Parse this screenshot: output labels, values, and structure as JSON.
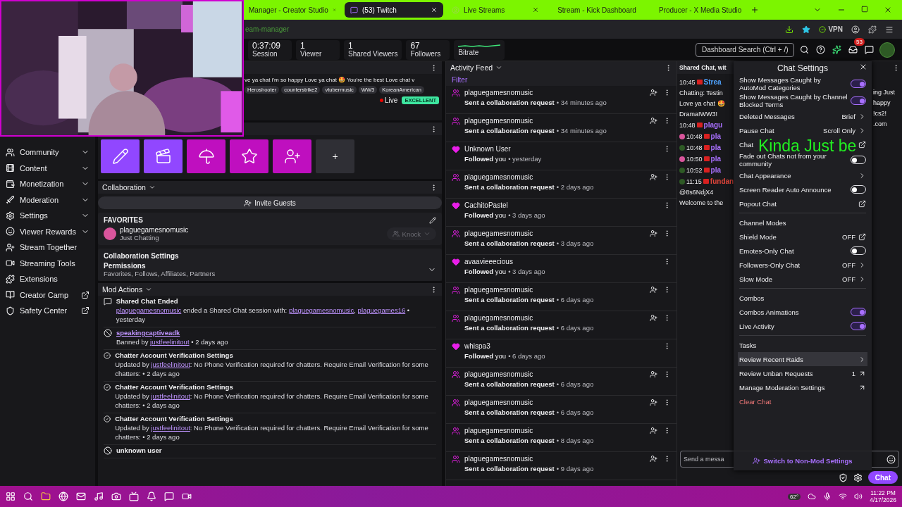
{
  "browser": {
    "tabs": [
      {
        "title": "Manager - Creator Studio",
        "selected": false,
        "kind": "studio"
      },
      {
        "title": "(53) Twitch",
        "selected": true,
        "kind": "twitch"
      },
      {
        "title": "Live Streams",
        "selected": false,
        "kind": "streams"
      },
      {
        "title": "Stream - Kick Dashboard",
        "selected": false,
        "kind": "kick"
      },
      {
        "title": "Producer - X Media Studio",
        "selected": false,
        "kind": "x"
      }
    ],
    "address": "eam-manager",
    "vpn": "VPN"
  },
  "stats": [
    {
      "kind": "number",
      "value": "0:37:09",
      "label": "Session"
    },
    {
      "kind": "number",
      "value": "1",
      "label": "Viewer"
    },
    {
      "kind": "number",
      "value": "1",
      "label": "Shared Viewers"
    },
    {
      "kind": "number",
      "value": "67",
      "label": "Followers"
    },
    {
      "kind": "graph",
      "label": "Bitrate"
    }
  ],
  "search": {
    "placeholder": "Dashboard Search (Ctrl + /)"
  },
  "notifications": {
    "count": "53"
  },
  "sidebar": {
    "items": [
      {
        "kind": "expandable",
        "label": "Community",
        "expanded": false
      },
      {
        "kind": "expandable",
        "label": "Content",
        "expanded": false
      },
      {
        "kind": "expandable",
        "label": "Monetization",
        "expanded": false
      },
      {
        "kind": "expandable",
        "label": "Moderation",
        "expanded": false
      },
      {
        "kind": "expandable",
        "label": "Settings",
        "expanded": false
      },
      {
        "kind": "expandable",
        "label": "Viewer Rewards",
        "expanded": false
      },
      {
        "kind": "link",
        "label": "Stream Together"
      },
      {
        "kind": "link",
        "label": "Streaming Tools"
      },
      {
        "kind": "link",
        "label": "Extensions"
      },
      {
        "kind": "external",
        "label": "Creator Camp"
      },
      {
        "kind": "external",
        "label": "Safety Center"
      }
    ]
  },
  "stream_info": {
    "title_text": "ve ya chat i'm so happy Love ya chat 🤩 You're the best Love chat v",
    "tags": [
      "Heroshooter",
      "counterstrike2",
      "vtubermusic",
      "WW3",
      "KoreanAmerican"
    ],
    "live_label": "Live",
    "health": "EXCELLENT"
  },
  "quick_actions": [
    {
      "kind": "pencil",
      "color": "#9147ff"
    },
    {
      "kind": "clapper",
      "color": "#9147ff"
    },
    {
      "kind": "umbrella",
      "color": "#bf0fbf"
    },
    {
      "kind": "star",
      "color": "#bf0fbf"
    },
    {
      "kind": "userplus",
      "color": "#bf0fbf"
    },
    {
      "kind": "add",
      "label": "+",
      "color": "#2f2f35"
    }
  ],
  "collaboration": {
    "title": "Collaboration",
    "invite": "Invite Guests",
    "favorites": {
      "heading": "FAVORITES",
      "user": "plaguegamesnomusic",
      "category": "Just Chatting",
      "knock": "Knock",
      "knock_disabled": true
    },
    "settings": {
      "title": "Collaboration Settings",
      "permissions": "Permissions",
      "permissions_value": "Favorites, Follows, Affiliates, Partners"
    }
  },
  "mod_actions": {
    "title": "Mod Actions",
    "items": [
      {
        "kind": "shared-chat",
        "title": "Shared Chat Ended",
        "title_link": false,
        "detail": [
          {
            "kind": "link",
            "text": "plaguegamesnomusic"
          },
          {
            "kind": "text",
            "text": " ended a Shared Chat session with: "
          },
          {
            "kind": "link",
            "text": "plaguegamesnomusic"
          },
          {
            "kind": "text",
            "text": ", "
          },
          {
            "kind": "link",
            "text": "plaguegames16"
          },
          {
            "kind": "text",
            "text": " • yesterday"
          }
        ]
      },
      {
        "kind": "ban",
        "title": "speakingcaptiveadk",
        "title_link": true,
        "detail": [
          {
            "kind": "text",
            "text": "Banned by "
          },
          {
            "kind": "link",
            "text": "justfeelinitout"
          },
          {
            "kind": "text",
            "text": " • 2 days ago"
          }
        ]
      },
      {
        "kind": "verified",
        "title": "Chatter Account Verification Settings",
        "title_link": false,
        "detail": [
          {
            "kind": "text",
            "text": "Updated by "
          },
          {
            "kind": "link",
            "text": "justfeelinitout"
          },
          {
            "kind": "text",
            "text": ": No Phone Verification required for chatters. Require Email Verification for some chatters:  • 2 days ago"
          }
        ]
      },
      {
        "kind": "verified",
        "title": "Chatter Account Verification Settings",
        "title_link": false,
        "detail": [
          {
            "kind": "text",
            "text": "Updated by "
          },
          {
            "kind": "link",
            "text": "justfeelinitout"
          },
          {
            "kind": "text",
            "text": ": No Phone Verification required for chatters. Require Email Verification for some chatters:  • 2 days ago"
          }
        ]
      },
      {
        "kind": "verified",
        "title": "Chatter Account Verification Settings",
        "title_link": false,
        "detail": [
          {
            "kind": "text",
            "text": "Updated by "
          },
          {
            "kind": "link",
            "text": "justfeelinitout"
          },
          {
            "kind": "text",
            "text": ": No Phone Verification required for chatters. Require Email Verification for some chatters:  • 2 days ago"
          }
        ]
      },
      {
        "kind": "ban",
        "title": "unknown user",
        "title_link": false
      }
    ]
  },
  "activity_feed": {
    "title": "Activity Feed",
    "filter": "Filter",
    "items": [
      {
        "kind": "collab",
        "user": "plaguegamesnomusic",
        "action": "Sent a collaboration request",
        "time": "• 34 minutes ago"
      },
      {
        "kind": "collab",
        "user": "plaguegamesnomusic",
        "action": "Sent a collaboration request",
        "time": "• 34 minutes ago"
      },
      {
        "kind": "follow",
        "user": "Unknown User",
        "action": "**Followed** you",
        "time": "• yesterday"
      },
      {
        "kind": "collab",
        "user": "plaguegamesnomusic",
        "action": "Sent a collaboration request",
        "time": "• 2 days ago"
      },
      {
        "kind": "follow",
        "user": "CachitoPastel",
        "action": "**Followed** you",
        "time": "• 3 days ago"
      },
      {
        "kind": "collab",
        "user": "plaguegamesnomusic",
        "action": "Sent a collaboration request",
        "time": "• 3 days ago"
      },
      {
        "kind": "follow",
        "user": "avaavieeecious",
        "action": "**Followed** you",
        "time": "• 3 days ago"
      },
      {
        "kind": "collab",
        "user": "plaguegamesnomusic",
        "action": "Sent a collaboration request",
        "time": "• 6 days ago"
      },
      {
        "kind": "collab",
        "user": "plaguegamesnomusic",
        "action": "Sent a collaboration request",
        "time": "• 6 days ago"
      },
      {
        "kind": "follow",
        "user": "whispa3",
        "action": "**Followed** you",
        "time": "• 6 days ago"
      },
      {
        "kind": "collab",
        "user": "plaguegamesnomusic",
        "action": "Sent a collaboration request",
        "time": "• 6 days ago"
      },
      {
        "kind": "collab",
        "user": "plaguegamesnomusic",
        "action": "Sent a collaboration request",
        "time": "• 6 days ago"
      },
      {
        "kind": "collab",
        "user": "plaguegamesnomusic",
        "action": "Sent a collaboration request",
        "time": "• 8 days ago"
      },
      {
        "kind": "collab",
        "user": "plaguegamesnomusic",
        "action": "Sent a collaboration request",
        "time": "• 9 days ago"
      }
    ]
  },
  "chat": {
    "header": "Shared Chat, wit",
    "lines": [
      {
        "kind": "message",
        "time": "10:45",
        "name": "Strea",
        "color": "#4fa3ff"
      },
      {
        "kind": "text",
        "text": "Chatting: Testin"
      },
      {
        "kind": "text",
        "text": "Love ya chat 🤩"
      },
      {
        "kind": "text",
        "text": "Drama!WW3!"
      },
      {
        "kind": "message",
        "time": "10:48",
        "name": "plagu",
        "color": "#a970ff"
      },
      {
        "kind": "message",
        "time": "10:48",
        "name": "pla",
        "color": "#a970ff",
        "avatar": {
          "color": "#d9559c"
        }
      },
      {
        "kind": "message",
        "time": "10:48",
        "name": "pla",
        "color": "#a970ff",
        "avatar": {
          "color": "#2e5a25"
        }
      },
      {
        "kind": "message",
        "time": "10:50",
        "name": "pla",
        "color": "#a970ff",
        "avatar": {
          "color": "#d9559c"
        }
      },
      {
        "kind": "message",
        "time": "10:52",
        "name": "pla",
        "color": "#a970ff",
        "avatar": {
          "color": "#2e5a25"
        }
      },
      {
        "kind": "message",
        "time": "11:15",
        "name": "fundan",
        "color": "#e0453a",
        "avatar": {
          "color": "#2e5a25"
        }
      },
      {
        "kind": "text",
        "text": "@8s6NdjX4"
      },
      {
        "kind": "text",
        "text": "Welcome to the"
      }
    ],
    "right_lines": [
      "ing Just",
      "happy",
      "!cs2!",
      ".com"
    ],
    "input_placeholder": "Send a messa",
    "chat_button": "Chat"
  },
  "chat_settings": {
    "title": "Chat Settings",
    "rows": [
      {
        "kind": "toggle",
        "label": "Show Messages Caught by AutoMod Categories",
        "checked": true
      },
      {
        "kind": "toggle",
        "label": "Show Messages Caught by Channel Blocked Terms",
        "checked": true
      },
      {
        "kind": "value",
        "label": "Deleted Messages",
        "value": "Brief"
      },
      {
        "kind": "value",
        "label": "Pause Chat",
        "value": "Scroll Only"
      },
      {
        "kind": "external",
        "label": "Chat"
      },
      {
        "kind": "toggle",
        "label": "Fade out Chats not from your community",
        "checked": false
      },
      {
        "kind": "nav",
        "label": "Chat Appearance",
        "highlighted": false
      },
      {
        "kind": "toggle",
        "label": "Screen Reader Auto Announce",
        "checked": false
      },
      {
        "kind": "external",
        "label": "Popout Chat"
      },
      {
        "kind": "divider"
      },
      {
        "kind": "heading",
        "label": "Channel Modes"
      },
      {
        "kind": "external",
        "label": "Shield Mode",
        "value": "OFF"
      },
      {
        "kind": "toggle",
        "label": "Emotes-Only Chat",
        "checked": false
      },
      {
        "kind": "value",
        "label": "Followers-Only Chat",
        "value": "OFF"
      },
      {
        "kind": "value",
        "label": "Slow Mode",
        "value": "OFF"
      },
      {
        "kind": "divider"
      },
      {
        "kind": "heading",
        "label": "Combos"
      },
      {
        "kind": "toggle",
        "label": "Combos Animations",
        "checked": true
      },
      {
        "kind": "toggle",
        "label": "Live Activity",
        "checked": true
      },
      {
        "kind": "divider"
      },
      {
        "kind": "heading",
        "label": "Tasks"
      },
      {
        "kind": "nav",
        "label": "Review Recent Raids",
        "highlighted": true
      },
      {
        "kind": "count-link",
        "label": "Review Unban Requests",
        "value": "1"
      },
      {
        "kind": "count-link",
        "label": "Manage Moderation Settings"
      },
      {
        "kind": "danger",
        "label": "Clear Chat"
      }
    ],
    "footer": "Switch to Non-Mod Settings"
  },
  "overlay_text": "Kinda Just be",
  "taskbar": {
    "weather": "62°",
    "time": "11:22 PM",
    "date": "4/17/2026"
  }
}
